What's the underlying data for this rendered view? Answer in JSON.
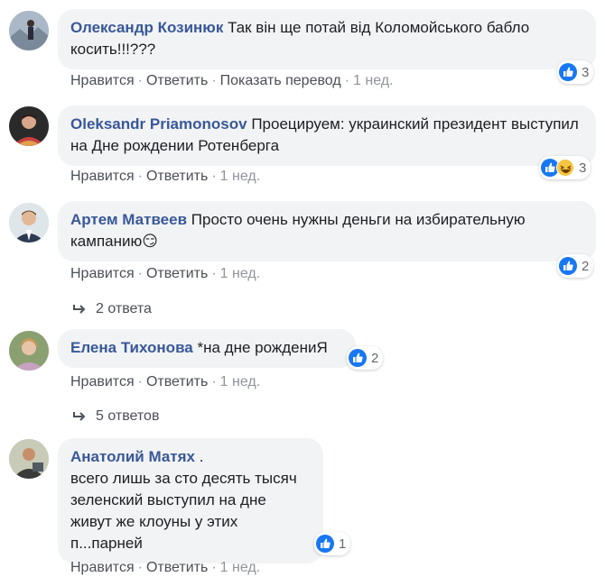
{
  "comments": [
    {
      "author": "Олександр Козинюк",
      "text": "Так він ще потай від Коломойського бабло косить!!!???",
      "actions": [
        "Нравится",
        "Ответить",
        "Показать перевод"
      ],
      "time": "1 нед.",
      "reactions": [
        "like"
      ],
      "reaction_count": "3"
    },
    {
      "author": "Oleksandr Priamonosov",
      "text": "Проецируем: украинский президент выступил на Дне рождении Ротенберга",
      "actions": [
        "Нравится",
        "Ответить"
      ],
      "time": "1 нед.",
      "reactions": [
        "like",
        "haha"
      ],
      "reaction_count": "3"
    },
    {
      "author": "Артем Матвеев",
      "text": "Просто очень нужны деньги на избирательную кампанию😏",
      "actions": [
        "Нравится",
        "Ответить"
      ],
      "time": "1 нед.",
      "reactions": [
        "like"
      ],
      "reaction_count": "2",
      "replies_label": "2 ответа"
    },
    {
      "author": "Елена Тихонова",
      "text": "*на дне рождениЯ",
      "actions": [
        "Нравится",
        "Ответить"
      ],
      "time": "1 нед.",
      "reactions": [
        "like"
      ],
      "reaction_count": "2",
      "replies_label": "5 ответов"
    },
    {
      "author": "Анатолий Матях",
      "text_lines": [
        ".",
        "всего лишь за сто десять тысяч",
        "зеленский выступил на дне",
        "живут же клоуны у этих",
        "п...парней"
      ],
      "actions": [
        "Нравится",
        "Ответить"
      ],
      "time": "1 нед.",
      "reactions": [
        "like"
      ],
      "reaction_count": "1"
    }
  ],
  "colors": {
    "author": "#385898",
    "bubble": "#f2f3f5",
    "like": "#1877f2",
    "meta": "#90949c"
  },
  "icons": [
    "like-icon",
    "haha-icon",
    "reply-arrow-icon"
  ]
}
